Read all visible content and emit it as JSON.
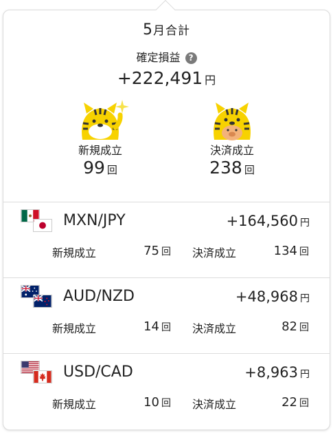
{
  "summary": {
    "month_number": "5",
    "month_suffix": "月合計",
    "pl_label": "確定損益",
    "help_icon_glyph": "?",
    "pl_amount": "+222,491",
    "yen_unit": "円",
    "new_label": "新規成立",
    "new_count": "99",
    "settle_label": "決済成立",
    "settle_count": "238",
    "count_unit": "回",
    "mascot_color": "#f7d200"
  },
  "pairs": [
    {
      "name": "MXN/JPY",
      "pl": "+164,560",
      "yen_unit": "円",
      "flags": [
        "mexico-flag",
        "japan-flag"
      ],
      "new_label": "新規成立",
      "new_count": "75",
      "settle_label": "決済成立",
      "settle_count": "134",
      "count_unit": "回"
    },
    {
      "name": "AUD/NZD",
      "pl": "+48,968",
      "yen_unit": "円",
      "flags": [
        "australia-flag",
        "new-zealand-flag"
      ],
      "new_label": "新規成立",
      "new_count": "14",
      "settle_label": "決済成立",
      "settle_count": "82",
      "count_unit": "回"
    },
    {
      "name": "USD/CAD",
      "pl": "+8,963",
      "yen_unit": "円",
      "flags": [
        "usa-flag",
        "canada-flag"
      ],
      "new_label": "新規成立",
      "new_count": "10",
      "settle_label": "決済成立",
      "settle_count": "22",
      "count_unit": "回"
    }
  ]
}
